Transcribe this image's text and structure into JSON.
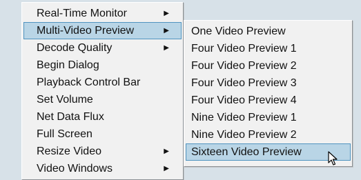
{
  "main_menu": {
    "items": [
      {
        "label": "Real-Time Monitor",
        "submenu_icon": "triangle-right-icon"
      },
      {
        "label": "Multi-Video Preview",
        "submenu_icon": "triangle-right-icon"
      },
      {
        "label": "Decode Quality",
        "submenu_icon": "triangle-right-icon"
      },
      {
        "label": "Begin Dialog"
      },
      {
        "label": "Playback Control Bar"
      },
      {
        "label": "Set Volume"
      },
      {
        "label": "Net Data Flux"
      },
      {
        "label": "Full Screen"
      },
      {
        "label": "Resize Video",
        "submenu_icon": "triangle-right-icon"
      },
      {
        "label": "Video Windows",
        "submenu_icon": "triangle-right-icon"
      }
    ],
    "highlighted": "Multi-Video Preview"
  },
  "sub_menu": {
    "items": [
      {
        "label": "One Video Preview"
      },
      {
        "label": "Four Video Preview 1"
      },
      {
        "label": "Four Video Preview 2"
      },
      {
        "label": "Four Video Preview 3"
      },
      {
        "label": "Four Video Preview 4"
      },
      {
        "label": "Nine Video Preview 1"
      },
      {
        "label": "Nine Video Preview 2"
      },
      {
        "label": "Sixteen Video Preview"
      }
    ],
    "highlighted": "Sixteen Video Preview"
  },
  "pointer": {
    "icon": "mouse-pointer-icon"
  },
  "colors": {
    "background": "#d7e1e8",
    "menu_background": "#f1f1f1",
    "highlight_fill": "#b9d5e6",
    "highlight_border": "#4f93bf"
  }
}
